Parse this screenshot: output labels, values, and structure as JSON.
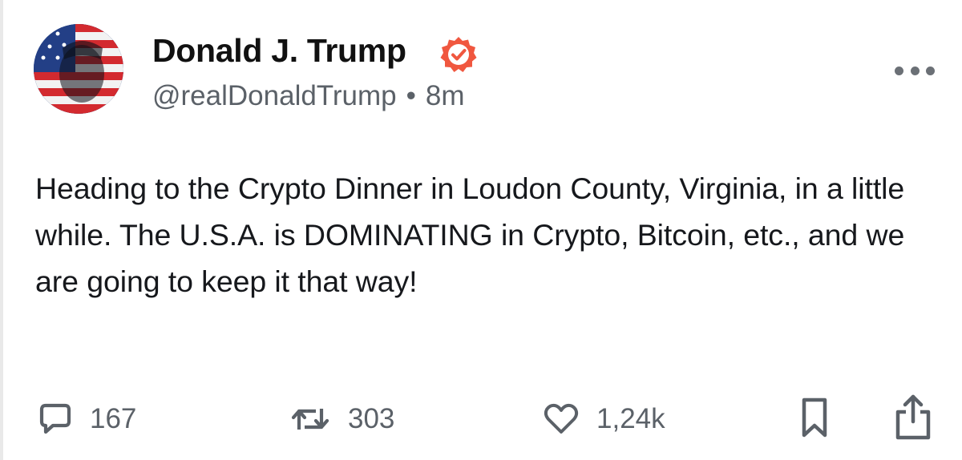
{
  "author": {
    "display_name": "Donald J. Trump",
    "handle": "@realDonaldTrump",
    "separator": "•",
    "timestamp": "8m",
    "verified": true,
    "badge_color": "#f0573f"
  },
  "post": {
    "text": "Heading to the Crypto Dinner in Loudon County, Virginia, in a little while. The U.S.A. is DOMINATING in Crypto, Bitcoin, etc., and we are going to keep it that way!"
  },
  "actions": {
    "replies": "167",
    "restates": "303",
    "likes": "1,24k"
  },
  "icons": [
    "verified-badge-icon",
    "more-options-icon",
    "reply-icon",
    "restate-icon",
    "like-icon",
    "bookmark-icon",
    "share-icon"
  ]
}
